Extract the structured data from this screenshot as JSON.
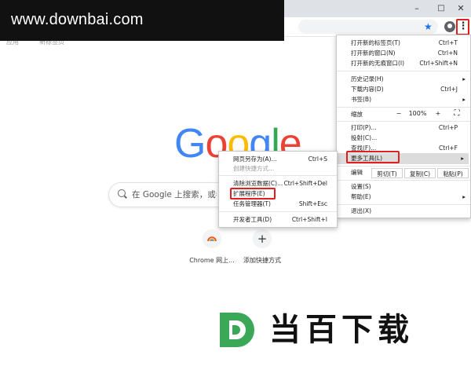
{
  "watermark": {
    "text": "www.downbai.com"
  },
  "window_controls": {
    "minimize": "–",
    "maximize": "□",
    "close": "✕"
  },
  "toolbar": {
    "star_icon": "★",
    "menu_icon": "⋮"
  },
  "bookmarks": [
    "应用",
    "新标签页"
  ],
  "google_logo": {
    "letters": [
      "G",
      "o",
      "o",
      "g",
      "l",
      "e"
    ],
    "colors": [
      "#4285F4",
      "#EA4335",
      "#FBBC05",
      "#4285F4",
      "#34A853",
      "#EA4335"
    ]
  },
  "search": {
    "placeholder": "在 Google 上搜索，或者输"
  },
  "shortcuts": [
    {
      "label": "Chrome 网上...",
      "icon": "rainbow-icon"
    },
    {
      "label": "添加快捷方式",
      "icon": "+"
    }
  ],
  "main_menu": {
    "group1": [
      {
        "label": "打开新的标签页(T)",
        "shortcut": "Ctrl+T"
      },
      {
        "label": "打开新的窗口(N)",
        "shortcut": "Ctrl+N"
      },
      {
        "label": "打开新的无痕窗口(I)",
        "shortcut": "Ctrl+Shift+N"
      }
    ],
    "group2": [
      {
        "label": "历史记录(H)",
        "arrow": "▸"
      },
      {
        "label": "下载内容(D)",
        "shortcut": "Ctrl+J"
      },
      {
        "label": "书签(B)",
        "arrow": "▸"
      }
    ],
    "zoom": {
      "label": "缩放",
      "minus": "−",
      "value": "100%",
      "plus": "+",
      "fullscreen": "⛶"
    },
    "group3": [
      {
        "label": "打印(P)...",
        "shortcut": "Ctrl+P"
      },
      {
        "label": "投射(C)..."
      },
      {
        "label": "查找(F)...",
        "shortcut": "Ctrl+F"
      },
      {
        "label": "更多工具(L)",
        "arrow": "▸"
      }
    ],
    "edit": {
      "label": "编辑",
      "cut": "剪切(T)",
      "copy": "复制(C)",
      "paste": "粘贴(P)"
    },
    "group4": [
      {
        "label": "设置(S)"
      },
      {
        "label": "帮助(E)",
        "arrow": "▸"
      }
    ],
    "exit": {
      "label": "退出(X)"
    }
  },
  "more_tools_menu": {
    "items": [
      {
        "label": "网页另存为(A)...",
        "shortcut": "Ctrl+S"
      },
      {
        "label": "创建快捷方式..."
      },
      {
        "label": "清除浏览数据(C)...",
        "shortcut": "Ctrl+Shift+Del"
      },
      {
        "label": "扩展程序(E)"
      },
      {
        "label": "任务管理器(T)",
        "shortcut": "Shift+Esc"
      },
      {
        "label": "开发者工具(D)",
        "shortcut": "Ctrl+Shift+I"
      }
    ]
  },
  "brand_logo": {
    "letter": "D",
    "text": "当百下载",
    "colors": {
      "green": "#3aa856",
      "dark": "#111111"
    }
  },
  "highlight_color": "#e02020"
}
